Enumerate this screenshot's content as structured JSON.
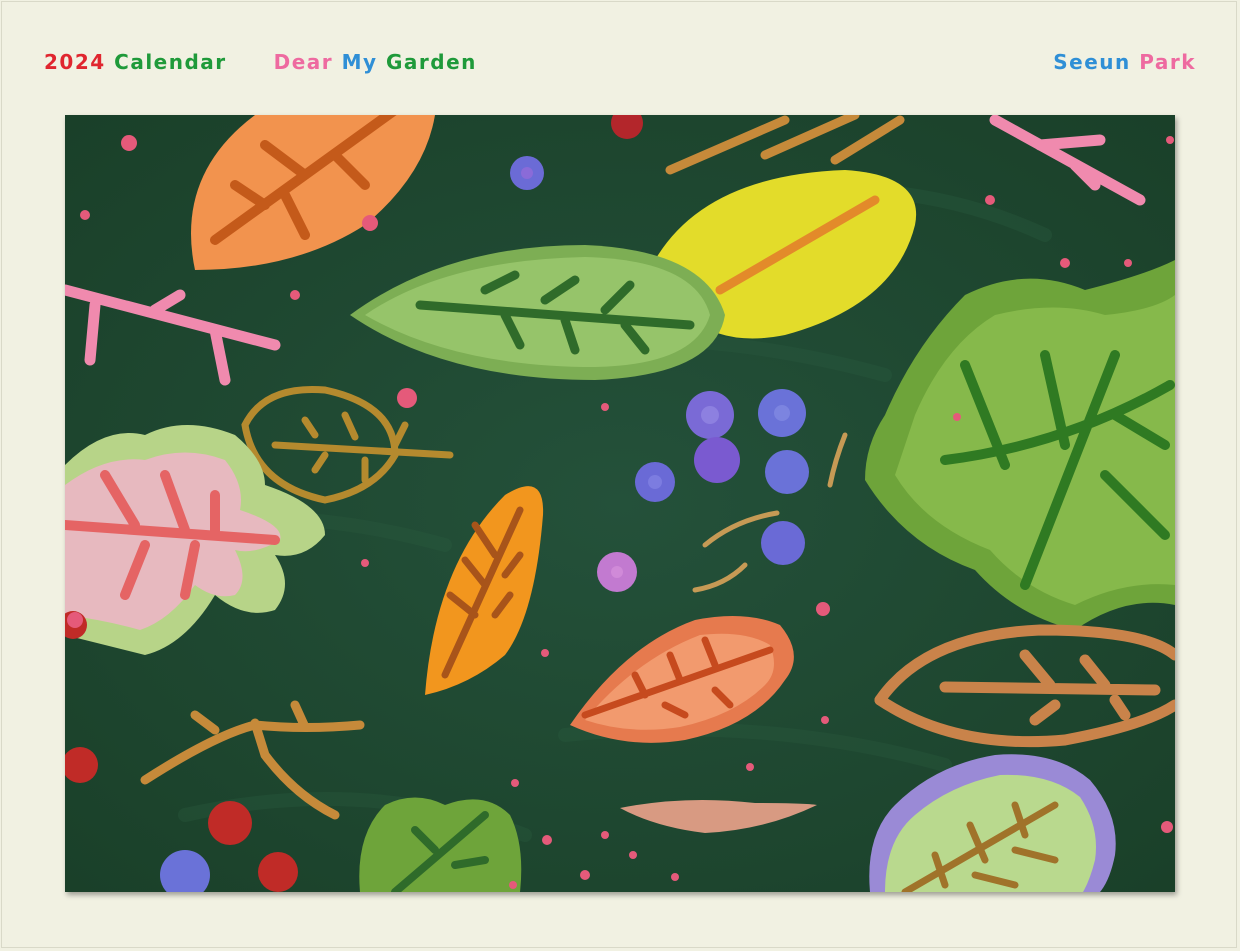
{
  "header": {
    "year": "2024",
    "calendar_word": "Calendar",
    "dear": "Dear",
    "my": "My",
    "garden": "Garden",
    "author_first": "Seeun",
    "author_last": "Park"
  },
  "colors": {
    "background": "#f1f1e2",
    "red": "#e0262f",
    "green": "#1f9a3a",
    "pink": "#ee6aa0",
    "blue": "#2f8fd6",
    "artwork_bg": "#1f4a30"
  }
}
